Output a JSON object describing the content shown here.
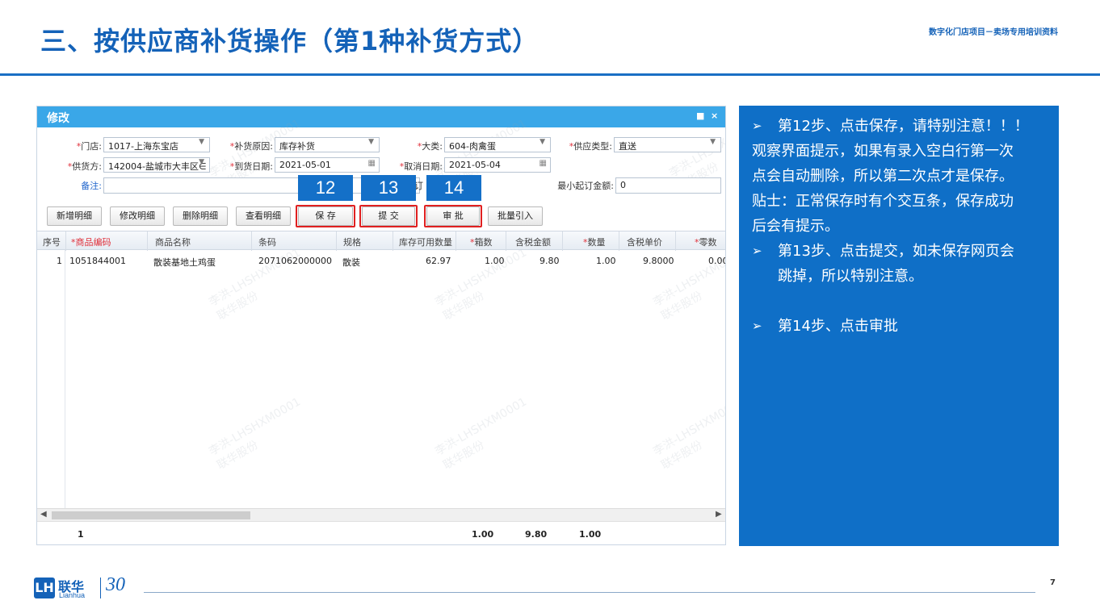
{
  "slide": {
    "title": "三、按供应商补货操作（第1种补货方式）",
    "subtitle": "数字化门店项目－卖场专用培训资料",
    "page_number": "7"
  },
  "window": {
    "title": "修改",
    "restore_icon": "■",
    "close_icon": "×"
  },
  "form": {
    "store_label": "门店:",
    "store_value": "1017-上海东宝店",
    "reason_label": "补货原因:",
    "reason_value": "库存补货",
    "category_label": "大类:",
    "category_value": "604-肉禽蛋",
    "supply_type_label": "供应类型:",
    "supply_type_value": "直送",
    "supplier_label": "供货方:",
    "supplier_value": "142004-盐城市大丰区∈",
    "arrival_label": "到货日期:",
    "arrival_value": "2021-05-01",
    "cancel_label": "取消日期:",
    "cancel_value": "2021-05-04",
    "remark_label": "备注:",
    "remark_value": "",
    "order_label_fragment": "订",
    "min_order_label": "最小起订金额:",
    "min_order_value": "0"
  },
  "toolbar": {
    "add": "新增明细",
    "edit": "修改明细",
    "delete": "删除明细",
    "view": "查看明细",
    "save": "保 存",
    "submit": "提 交",
    "approve": "审 批",
    "import": "批量引入"
  },
  "steps": {
    "s12": "12",
    "s13": "13",
    "s14": "14"
  },
  "grid": {
    "columns": [
      "序号",
      "商品编码",
      "商品名称",
      "条码",
      "规格",
      "库存可用数量",
      "箱数",
      "含税金额",
      "数量",
      "含税单价",
      "零数"
    ],
    "row": [
      "1",
      "1051844001",
      "散装基地土鸡蛋",
      "2071062000000",
      "散装",
      "62.97",
      "1.00",
      "9.80",
      "1.00",
      "9.8000",
      "0.00"
    ],
    "footer": {
      "count": "1",
      "boxes": "1.00",
      "amount": "9.80",
      "qty": "1.00"
    },
    "scroll_left": "◀",
    "scroll_right": "▶"
  },
  "watermark": {
    "line1": "李洪-LHSHXM0001",
    "line2": "联华股份"
  },
  "notes": {
    "arrow": "➢",
    "step12_line1": "第12步、点击保存，请特别注意！！！",
    "step12_line2": "观察界面提示，如果有录入空白行第一次",
    "step12_line3": "点会自动删除，所以第二次点才是保存。",
    "step12_line4": "贴士：正常保存时有个交互条，保存成功",
    "step12_line5": "后会有提示。",
    "step13_line1": "第13步、点击提交，如未保存网页会",
    "step13_line2": "跳掉，所以特别注意。",
    "step14_line1": "第14步、点击审批"
  },
  "logo": {
    "mark": "LH",
    "cn": "联华",
    "en": "Lianhua",
    "anniversary": "30"
  },
  "colors": {
    "brand_blue": "#1462b8",
    "header_blue": "#3aa7e8",
    "panel_blue": "#0f6fc7",
    "highlight_red": "#e02020"
  }
}
